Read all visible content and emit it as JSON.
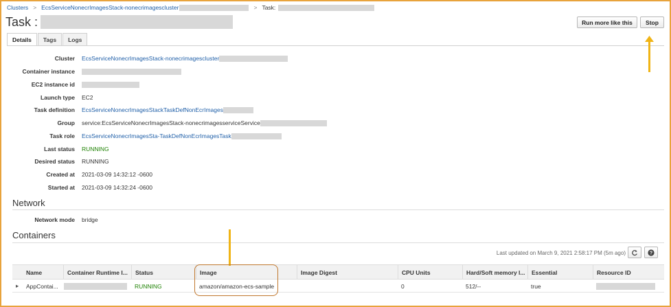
{
  "breadcrumb": {
    "clusters": "Clusters",
    "separator": ">",
    "cluster_name": "EcsServiceNonecrImagesStack-nonecrimagescluster",
    "task_prefix": "Task:"
  },
  "header": {
    "title": "Task :",
    "run_more_label": "Run more like this",
    "stop_label": "Stop"
  },
  "tabs": [
    {
      "label": "Details",
      "active": true
    },
    {
      "label": "Tags",
      "active": false
    },
    {
      "label": "Logs",
      "active": false
    }
  ],
  "details": {
    "cluster": {
      "label": "Cluster",
      "value": "EcsServiceNonecrImagesStack-nonecrimagescluster"
    },
    "container_instance": {
      "label": "Container instance"
    },
    "ec2_instance_id": {
      "label": "EC2 instance id"
    },
    "launch_type": {
      "label": "Launch type",
      "value": "EC2"
    },
    "task_definition": {
      "label": "Task definition",
      "value": "EcsServiceNonecrImagesStackTaskDefNonEcrImages"
    },
    "group": {
      "label": "Group",
      "value": "service:EcsServiceNonecrImagesStack-nonecrimagesserviceService"
    },
    "task_role": {
      "label": "Task role",
      "value": "EcsServiceNonecrImagesSta-TaskDefNonEcrImagesTask"
    },
    "last_status": {
      "label": "Last status",
      "value": "RUNNING"
    },
    "desired_status": {
      "label": "Desired status",
      "value": "RUNNING"
    },
    "created_at": {
      "label": "Created at",
      "value": "2021-03-09 14:32:12 -0600"
    },
    "started_at": {
      "label": "Started at",
      "value": "2021-03-09 14:32:24 -0600"
    }
  },
  "network": {
    "title": "Network",
    "mode_label": "Network mode",
    "mode_value": "bridge"
  },
  "containers": {
    "title": "Containers",
    "last_updated": "Last updated on March 9, 2021 2:58:17 PM (5m ago)",
    "icons": [
      "refresh-icon",
      "help-icon"
    ],
    "columns": [
      "Name",
      "Container Runtime I...",
      "Status",
      "Image",
      "Image Digest",
      "CPU Units",
      "Hard/Soft memory l...",
      "Essential",
      "Resource ID"
    ],
    "rows": [
      {
        "expand": "▸",
        "name": "AppContai...",
        "status": "RUNNING",
        "image": "amazon/amazon-ecs-sample",
        "cpu": "0",
        "memory": "512/--",
        "essential": "true"
      }
    ]
  },
  "colors": {
    "link": "#1f5fa8",
    "status_green": "#1d8102",
    "annotation_arrow": "#f0b416",
    "annotation_box": "#c0772d",
    "frame": "#e8a33c"
  }
}
